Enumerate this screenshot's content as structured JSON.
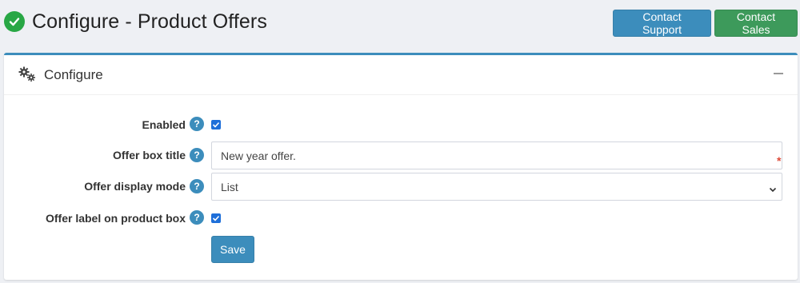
{
  "header": {
    "title": "Configure - Product Offers",
    "contact_support_label": "Contact Support",
    "contact_sales_label": "Contact Sales"
  },
  "panel": {
    "title": "Configure",
    "icon": "gears-icon",
    "collapse_icon": "minus-icon"
  },
  "form": {
    "enabled": {
      "label": "Enabled",
      "checked": true
    },
    "offer_box_title": {
      "label": "Offer box title",
      "value": "New year offer.",
      "required_mark": "*"
    },
    "offer_display_mode": {
      "label": "Offer display mode",
      "selected": "List"
    },
    "offer_label_on_product_box": {
      "label": "Offer label on product box",
      "checked": true
    },
    "help_glyph": "?",
    "save_label": "Save"
  },
  "colors": {
    "primary": "#3c8dbc",
    "success": "#3d9a5b",
    "check": "#28a745",
    "required": "#dd4b39"
  }
}
